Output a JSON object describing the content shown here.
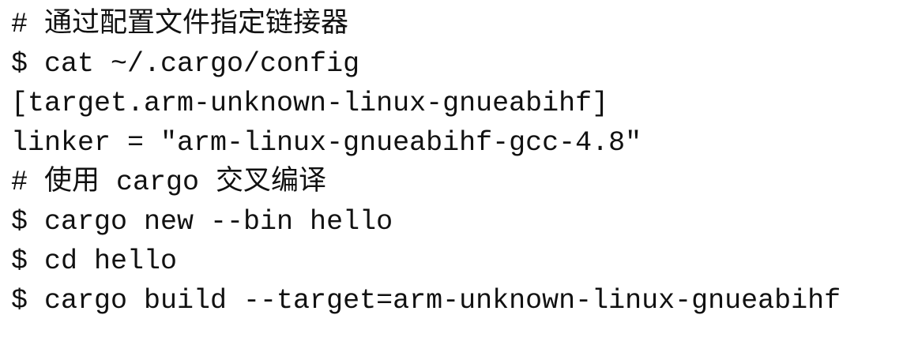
{
  "code": {
    "lines": [
      "# 通过配置文件指定链接器",
      "$ cat ~/.cargo/config",
      "[target.arm-unknown-linux-gnueabihf]",
      "linker = \"arm-linux-gnueabihf-gcc-4.8\"",
      "# 使用 cargo 交叉编译",
      "$ cargo new --bin hello",
      "$ cd hello",
      "$ cargo build --target=arm-unknown-linux-gnueabihf"
    ]
  }
}
